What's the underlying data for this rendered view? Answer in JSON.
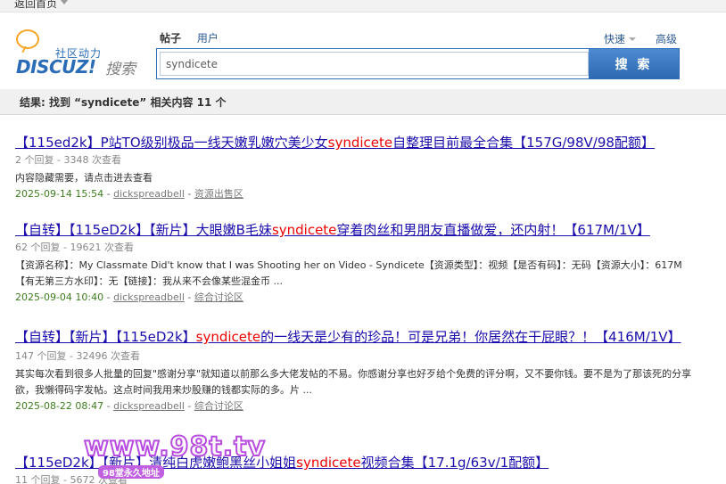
{
  "topbar": {
    "back_label": "返回首页"
  },
  "logo": {
    "sub": "社区动力",
    "brand": "DISCUZ!",
    "search_word": "搜索"
  },
  "tabs": {
    "posts": "帖子",
    "users": "用户"
  },
  "search": {
    "value": "syndicete",
    "button": "搜 索",
    "quick": "快速",
    "advanced": "高级"
  },
  "result_summary": "结果: 找到 “syndicete” 相关内容 11 个",
  "results": [
    {
      "title_pre": "【115ed2k】P站TO级别极品一线天嫩乳嫩穴美少女",
      "title_hl": "syndicete",
      "title_post": "自整理目前最全合集【157G/98V/98配额】",
      "meta": "2 个回复 - 3348 次查看",
      "desc": "内容隐藏需要，请点击进去查看",
      "date": "2025-09-14 15:54",
      "author": "dickspreadbell",
      "forum": "资源出售区"
    },
    {
      "title_pre": "【自转】【115eD2k】【新片】大眼嫩B毛妹",
      "title_hl": "syndicete",
      "title_post": "穿着肉丝和男朋友直播做爱，还内射！【617M/1V】",
      "meta": "62 个回复 - 19621 次查看",
      "desc": "【资源名称】：My Classmate Did't know that I was Shooting her on Video - Syndicete【资源类型】：视频【是否有码】：无码【资源大小】：617M【有无第三方水印】：无【链接】：我从来不会像某些混金币 ...",
      "date": "2025-09-04 10:40",
      "author": "dickspreadbell",
      "forum": "综合讨论区"
    },
    {
      "title_pre": "【自转】【新片】【115eD2k】",
      "title_hl": "syndicete",
      "title_post": "的一线天是少有的珍品！可是兄弟！你居然在干屁眼？！【416M/1V】",
      "meta": "147 个回复 - 32496 次查看",
      "desc": "其实每次看到很多人批量的回复\"感谢分享\"就知道以前那么多大佬发帖的不易。你感谢分享也好歹给个免费的评分啊，又不要你钱。要不是为了那该死的分享欲，我懒得码字发帖。这点时间我用来炒股赚的钱都实际的多。片 ...",
      "date": "2025-08-22 08:47",
      "author": "dickspreadbell",
      "forum": "综合讨论区"
    },
    {
      "title_pre": "【115eD2k】【新片】清纯白虎嫩鲍黑丝小姐姐",
      "title_hl": "syndicete",
      "title_post": "视频合集【17.1g/63v/1配额】",
      "meta": "11 个回复 - 5672 次查看"
    }
  ],
  "watermark": {
    "text": "www.98t.tv",
    "sub": "98堂永久地址"
  }
}
